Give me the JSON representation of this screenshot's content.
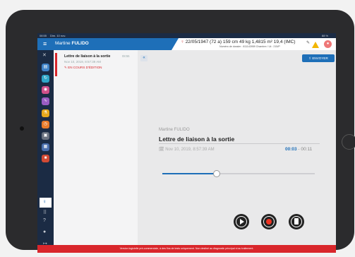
{
  "status_bar": {
    "time": "08:55",
    "date": "Dim. 10 nov.",
    "battery": "88 %"
  },
  "header": {
    "patient_first": "Martine",
    "patient_last": "FULIDO",
    "gender_symbol": "♀",
    "birthdate_age": "22/05/1947 (72 a)",
    "height": "159 cm",
    "weight": "49 kg",
    "bsa": "1,4815 m²",
    "bmi": "19,4 (IMC)",
    "dossier": "Numéro de dossier : 811143959   Chambre / Lit : 215/P"
  },
  "list": {
    "items": [
      {
        "title": "Lettre de liaison à la sortie",
        "time": "08:55",
        "date": "Nov 10, 2019, 8:57:39 AM",
        "status": "EN COURS D'ÉDITION"
      }
    ]
  },
  "panel": {
    "send_label": "ENVOYER",
    "author": "Martine FULIDO",
    "title": "Lettre de liaison à la sortie",
    "date": "Nov 10, 2019, 8:57:39 AM",
    "elapsed": "00:03",
    "total": "00:11",
    "progress": 0.35
  },
  "footer": {
    "text": "Version logicielle pré-commerciale, à des fins de tests uniquement. Non destiné au diagnostic principal ni au traitement."
  },
  "colors": {
    "accent": "#1e6fb8",
    "sidebar": "#1b2b44",
    "alert": "#d9262b"
  },
  "sidebar_icons": [
    "close-icon",
    "folder-icon",
    "refresh-icon",
    "pill-icon",
    "chart-icon",
    "flask-icon",
    "clock-icon",
    "printer-icon",
    "document-icon",
    "record-icon",
    "microphone-icon",
    "grid-icon",
    "help-icon",
    "location-icon",
    "logout-icon"
  ]
}
